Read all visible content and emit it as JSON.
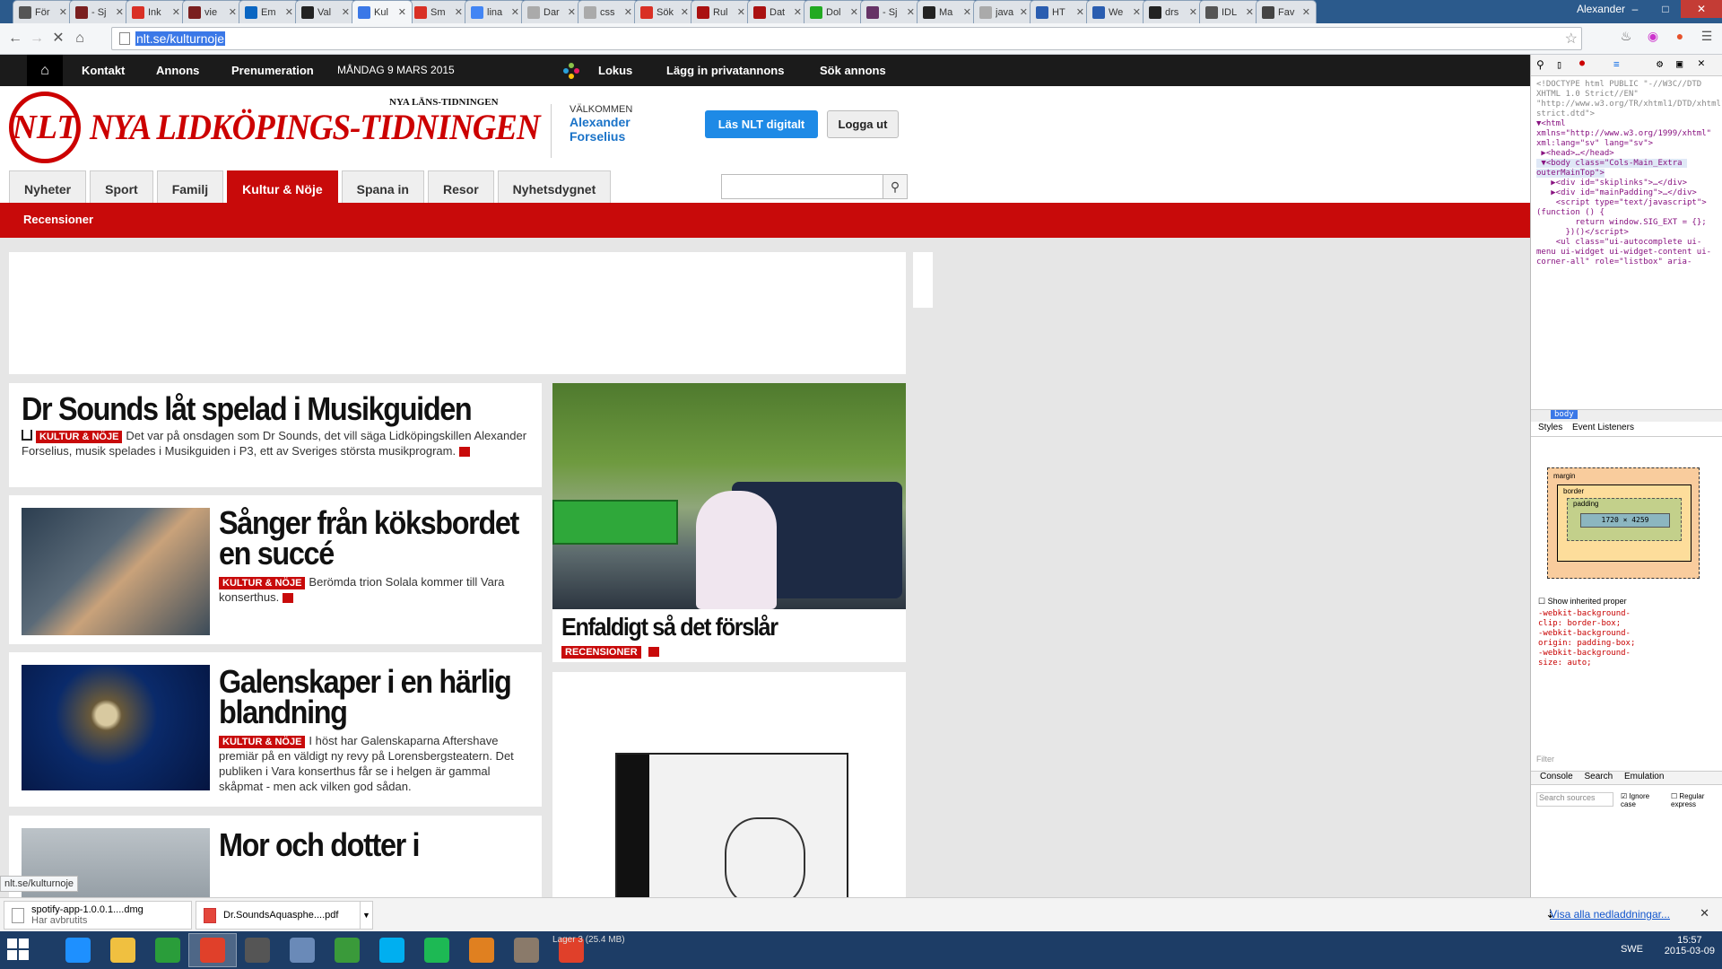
{
  "browser": {
    "tabs": [
      {
        "title": "För",
        "color": "#555"
      },
      {
        "title": "- Sj",
        "color": "#7a1f1f"
      },
      {
        "title": "Ink",
        "color": "#d93025"
      },
      {
        "title": "vie",
        "color": "#7a1f1f"
      },
      {
        "title": "Em",
        "color": "#0a66c2"
      },
      {
        "title": "Val",
        "color": "#222"
      },
      {
        "title": "Kul",
        "color": "#3b78e7"
      },
      {
        "title": "Sm",
        "color": "#d93025"
      },
      {
        "title": "lina",
        "color": "#4285f4"
      },
      {
        "title": "Dar",
        "color": "#aaa"
      },
      {
        "title": "css",
        "color": "#aaa"
      },
      {
        "title": "Sök",
        "color": "#d93025"
      },
      {
        "title": "Rul",
        "color": "#a11"
      },
      {
        "title": "Dat",
        "color": "#a11"
      },
      {
        "title": "Dol",
        "color": "#2a2"
      },
      {
        "title": "- Sj",
        "color": "#636"
      },
      {
        "title": "Ma",
        "color": "#222"
      },
      {
        "title": "java",
        "color": "#aaa"
      },
      {
        "title": "HT",
        "color": "#2a5db0"
      },
      {
        "title": "We",
        "color": "#2a5db0"
      },
      {
        "title": "drs",
        "color": "#222"
      },
      {
        "title": "IDL",
        "color": "#555"
      },
      {
        "title": "Fav",
        "color": "#444"
      }
    ],
    "active_tab_index": 6,
    "user": "Alexander",
    "url": "nlt.se/kulturnoje"
  },
  "site": {
    "topnav": {
      "links": [
        "Kontakt",
        "Annons",
        "Prenumeration"
      ],
      "date": "MÅNDAG 9 MARS 2015",
      "right_links": [
        "Lokus",
        "Lägg in privatannons",
        "Sök annons"
      ]
    },
    "logo": {
      "initials": "NLT",
      "title": "NYA LIDKÖPINGS-TIDNINGEN",
      "subtitle": "NYA LÄNS-TIDNINGEN"
    },
    "welcome": {
      "label": "VÄLKOMMEN",
      "name": "Alexander Forselius"
    },
    "read_digital": "Läs NLT digitalt",
    "logout": "Logga ut",
    "tabs": [
      "Nyheter",
      "Sport",
      "Familj",
      "Kultur & Nöje",
      "Spana in",
      "Resor",
      "Nyhetsdygnet"
    ],
    "active_tab": 3,
    "subnav": "Recensioner"
  },
  "articles": [
    {
      "title": "Dr Sounds låt spelad i Musikguiden",
      "kicker": "KULTUR & NÖJE",
      "text": "Det var på onsdagen som Dr Sounds, det vill säga Lidköpingskillen Alexander Forselius, musik spelades i Musikguiden i P3, ett av Sveriges största musikprogram."
    },
    {
      "title": "Sånger från köksbordet en succé",
      "kicker": "KULTUR & NÖJE",
      "text": "Berömda trion Solala kommer till Vara konserthus."
    },
    {
      "title": "Galenskaper i en härlig blandning",
      "kicker": "KULTUR & NÖJE",
      "text": "I höst har Galenskaparna Aftershave premiär på en väldigt ny revy på Lorensbergsteatern. Det publiken i Vara konserthus får se i helgen är gammal skåpmat - men ack vilken god sådan."
    },
    {
      "title": "Mor och dotter i"
    }
  ],
  "feature": {
    "title": "Enfaldigt så det förslår",
    "kicker": "RECENSIONER"
  },
  "devtools": {
    "body_crumb": "body",
    "tabs_styles": [
      "Styles",
      "Event Listeners"
    ],
    "box_labels": {
      "margin": "margin",
      "border": "border",
      "padding": "padding",
      "content": "1720 × 4259"
    },
    "show_inherited": "Show inherited proper",
    "props": [
      "-webkit-background-",
      "clip: border-box;",
      "-webkit-background-",
      "origin: padding-box;",
      "-webkit-background-",
      "size: auto;"
    ],
    "filter": "Filter",
    "bottom_tabs": [
      "Console",
      "Search",
      "Emulation"
    ],
    "search_placeholder": "Search sources",
    "ignore_case": "Ignore case",
    "regular": "Regular express"
  },
  "status_url": "nlt.se/kulturnoje",
  "downloads": [
    {
      "name": "spotify-app-1.0.0.1....dmg",
      "status": "Har avbrutits"
    },
    {
      "name": "Dr.SoundsAquasphe....pdf",
      "status": ""
    }
  ],
  "show_all_downloads": "Visa alla nedladdningar...",
  "taskbar": {
    "lang": "SWE",
    "time": "15:57",
    "date": "2015-03-09",
    "overlay_text": "Lager 3 (25.4 MB)"
  }
}
